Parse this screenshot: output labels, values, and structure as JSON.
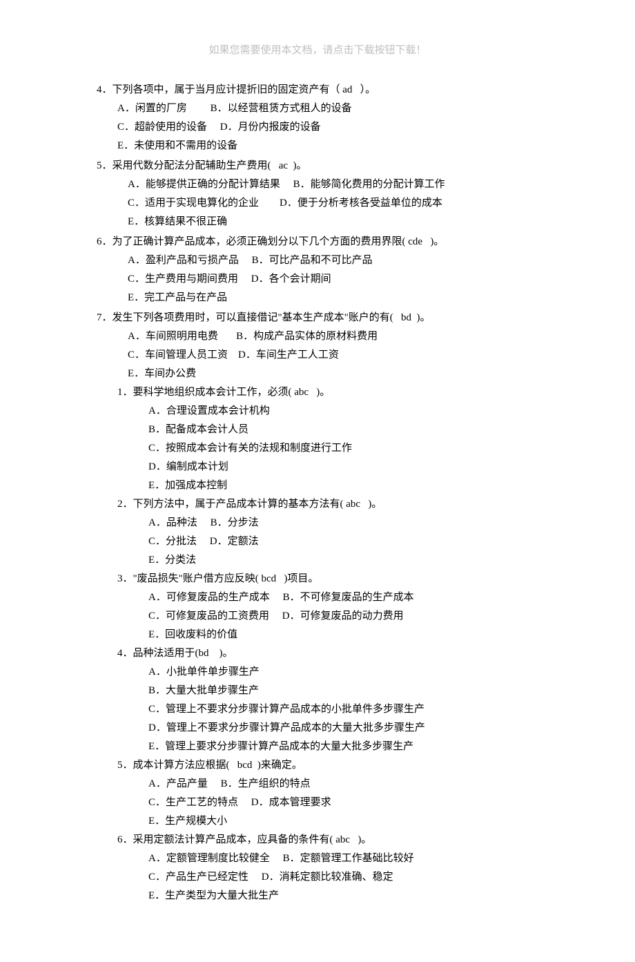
{
  "header_note": "如果您需要使用本文档，请点击下载按钮下载！",
  "q4": {
    "stem": "4．下列各项中，属于当月应计提折旧的固定资产有（ ad   ）。",
    "opt_ab": "A．闲置的厂房         B．以经营租赁方式租人的设备",
    "opt_cd": "C．超龄使用的设备     D．月份内报废的设备",
    "opt_e": "E．未使用和不需用的设备"
  },
  "q5": {
    "stem": "5．采用代数分配法分配辅助生产费用(   ac  )。",
    "opt_ab": "A．能够提供正确的分配计算结果     B．能够简化费用的分配计算工作",
    "opt_cd": "C．适用于实现电算化的企业        D．便于分析考核各受益单位的成本",
    "opt_e": "E．核算结果不很正确"
  },
  "q6": {
    "stem": "6．为了正确计算产品成本，必须正确划分以下几个方面的费用界限( cde   )。",
    "opt_ab": "A．盈利产品和亏损产品     B．可比产品和不可比产品",
    "opt_cd": "C．生产费用与期间费用     D．各个会计期间",
    "opt_e": "E．完工产品与在产品"
  },
  "q7": {
    "stem": "7．发生下列各项费用时，可以直接借记\"基本生产成本\"账户的有(   bd  )。",
    "opt_ab": "A．车间照明用电费       B．构成产品实体的原材料费用",
    "opt_cd": "C．车间管理人员工资    D．车间生产工人工资",
    "opt_e": "E．车间办公费"
  },
  "s1": {
    "stem": "1．要科学地组织成本会计工作，必须( abc   )。",
    "a": "A．合理设置成本会计机构",
    "b": "B．配备成本会计人员",
    "c": "C．按照成本会计有关的法规和制度进行工作",
    "d": "D．编制成本计划",
    "e": "E．加强成本控制"
  },
  "s2": {
    "stem": "2．下列方法中，属于产品成本计算的基本方法有( abc   )。",
    "ab": "A．品种法     B．分步法",
    "cd": "C．分批法     D．定额法",
    "e": "E．分类法"
  },
  "s3": {
    "stem": "3．\"废品损失\"账户借方应反映( bcd   )项目。",
    "ab": "A．可修复废品的生产成本     B．不可修复废品的生产成本",
    "cd": "C．可修复废品的工资费用     D．可修复废品的动力费用",
    "e": "E．回收废料的价值"
  },
  "s4": {
    "stem": "4．品种法适用于(bd    )。",
    "a": "A．小批单件单步骤生产",
    "b": "B．大量大批单步骤生产",
    "c": "C．管理上不要求分步骤计算产品成本的小批单件多步骤生产",
    "d": "D．管理上不要求分步骤计算产品成本的大量大批多步骤生产",
    "e": "E．管理上要求分步骤计算产品成本的大量大批多步骤生产"
  },
  "s5": {
    "stem": "5．成本计算方法应根据(   bcd  )来确定。",
    "ab": "A．产品产量     B．生产组织的特点",
    "cd": "C．生产工艺的特点     D．成本管理要求",
    "e": "E．生产规模大小"
  },
  "s6": {
    "stem": "6．采用定额法计算产品成本，应具备的条件有( abc   )。",
    "ab": "A．定额管理制度比较健全     B．定额管理工作基础比较好",
    "cd": "C．产品生产已经定性     D．消耗定额比较准确、稳定",
    "e": "E．生产类型为大量大批生产"
  }
}
